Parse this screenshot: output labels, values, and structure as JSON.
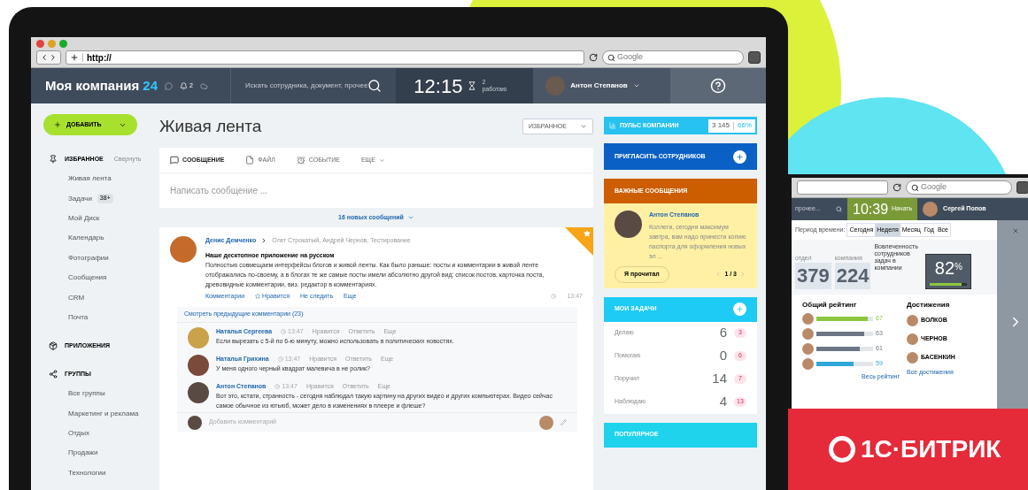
{
  "browser": {
    "url": "http://",
    "search_placeholder": "Google"
  },
  "header": {
    "company": "Моя компания",
    "company_suffix": "24",
    "notification_count": "2",
    "search_placeholder": "Искать сотрудника, документ, прочее",
    "clock": "12:15",
    "work_count": "2",
    "work_status": "работаю",
    "user": "Антон Степанов"
  },
  "add_button": {
    "label": "ДОБАВИТЬ"
  },
  "sidebar": {
    "sections": [
      {
        "kind": "favorites",
        "title": "ИЗБРАННОЕ",
        "action": "Свернуть",
        "items": [
          {
            "label": "Живая лента"
          },
          {
            "label": "Задачи",
            "badge": "38+"
          },
          {
            "label": "Мой Диск"
          },
          {
            "label": "Календарь"
          },
          {
            "label": "Фотографии"
          },
          {
            "label": "Сообщения"
          },
          {
            "label": "CRM"
          },
          {
            "label": "Почта"
          }
        ]
      },
      {
        "kind": "apps",
        "title": "ПРИЛОЖЕНИЯ"
      },
      {
        "kind": "groups",
        "title": "ГРУППЫ",
        "items": [
          {
            "label": "Все группы"
          },
          {
            "label": "Маркетинг и реклама"
          },
          {
            "label": "Отдых"
          },
          {
            "label": "Продажи"
          },
          {
            "label": "Технологии"
          }
        ]
      }
    ]
  },
  "feed": {
    "title": "Живая лента",
    "filter": "ИЗБРАННОЕ",
    "composer": {
      "tabs": [
        {
          "label": "СООБЩЕНИЕ",
          "selected": true
        },
        {
          "label": "ФАЙЛ",
          "selected": false
        },
        {
          "label": "СОБЫТИЕ",
          "selected": false
        },
        {
          "label": "ЕЩЕ",
          "selected": false
        }
      ],
      "placeholder": "Написать сообщение ..."
    },
    "new_messages": "16 новых сообщений",
    "post": {
      "important": true,
      "author": "Денис Демченко",
      "recipients": "Олег Строкатый, Андрей Чернов, Тестирование",
      "title": "Наше десктопное приложение на русском",
      "text": "Полностью совмещаем интерфейсы блогов и живой ленты. Как было раньше: посты и комментарии в живой ленте отображались по-своему, а в блогах те же самые посты имели абсолютно другой вид: список постов, карточка поста, древовидные комментарии, виз. редактор в комментариях.",
      "actions": [
        "Комментарии",
        "Нравится",
        "Не следить",
        "Еще"
      ],
      "time": "13:47",
      "more_comments": "Смотреть предыдущие комментарии (23)",
      "comments": [
        {
          "author": "Наталья Сергеева",
          "time": "13:47",
          "actions": [
            "Нравится",
            "Ответить",
            "Еще"
          ],
          "text": "Если вырезать с 5-й по 6-ю минуту, можно использовать в политических новостях."
        },
        {
          "author": "Наталья Грихина",
          "time": "13:47",
          "actions": [
            "Нравится",
            "Ответить",
            "Еще"
          ],
          "text": "У меня одного черный квадрат малевича в не ролик?"
        },
        {
          "author": "Антон Степанов",
          "time": "13:47",
          "actions": [
            "Нравится",
            "Ответить",
            "Еще"
          ],
          "text": "Вот это, кстати, странность - сегодня наблюдал такую картину на других видео и других компьютерах. Видео сейчас самое обычное из ютьюб, может дело в изменениях в плеере и флеше?"
        }
      ],
      "add_comment": "Добавить комментарий"
    }
  },
  "right": {
    "pulse": {
      "label": "ПУЛЬС КОМПАНИИ",
      "count": "3 145",
      "percent": "66%"
    },
    "invite": "ПРИГЛАСИТЬ СОТРУДНИКОВ",
    "important": {
      "title": "ВАЖНЫЕ СООБЩЕНИЯ",
      "author": "Антон Степанов",
      "text": "Коллеги, сегодня максимум завтра, вам надо принести копию паспорта для оформления новых эл ...",
      "button": "Я прочитал",
      "page": "1 / 3"
    },
    "tasks": {
      "title": "МОИ ЗАДАЧИ",
      "rows": [
        {
          "label": "Делаю",
          "count": "6",
          "badge": "3"
        },
        {
          "label": "Помогаю",
          "count": "0",
          "badge": "6"
        },
        {
          "label": "Поручил",
          "count": "14",
          "badge": "7"
        },
        {
          "label": "Наблюдаю",
          "count": "4",
          "badge": "13"
        }
      ]
    },
    "popular": "ПОПУЛЯРНОЕ"
  },
  "second_device": {
    "search_placeholder": "Google",
    "search_fragment": "прочее...",
    "clock": "10:39",
    "clock_action": "Начать",
    "user": "Сергей Попов",
    "period_label": "Период времени:",
    "periods": [
      {
        "label": "Сегодня",
        "selected": false
      },
      {
        "label": "Неделя",
        "selected": true
      },
      {
        "label": "Месяц",
        "selected": false
      },
      {
        "label": "Год",
        "selected": false
      },
      {
        "label": "Все",
        "selected": false
      }
    ],
    "stats": [
      {
        "label": "отдел",
        "value": "379"
      },
      {
        "label": "компания",
        "value": "224"
      }
    ],
    "engagement": {
      "label": "Вовлеченность сотрудников задач в компании",
      "value": "82",
      "unit": "%",
      "level": 0.85
    },
    "rating": {
      "title": "Общий рейтинг",
      "rows": [
        {
          "value": "67",
          "level": 0.9,
          "color": "#8cc63f"
        },
        {
          "value": "63",
          "level": 0.84,
          "color": "#6b7585"
        },
        {
          "value": "61",
          "level": 0.76,
          "color": "#6b7585"
        },
        {
          "value": "59",
          "level": 0.66,
          "color": "#2fa8d8"
        }
      ],
      "link": "Весь рейтинг"
    },
    "achievements": {
      "title": "Достижения",
      "items": [
        {
          "name": "ВОЛКОВ"
        },
        {
          "name": "ЧЕРНОВ"
        },
        {
          "name": "БАСЕНКИН"
        }
      ],
      "link": "Все достижения"
    }
  },
  "brand": {
    "logo": "1С·БИТРИК"
  }
}
